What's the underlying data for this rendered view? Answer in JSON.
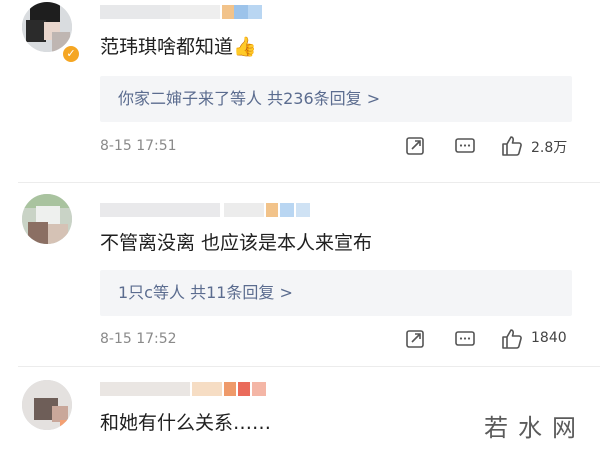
{
  "comments": [
    {
      "text": "范玮琪啥都知道👍",
      "reply_link": "你家二婶子来了等人  共236条回复 >",
      "date": "8-15 17:51",
      "likes": "2.8万",
      "verified": true
    },
    {
      "text": "不管离没离 也应该是本人来宣布",
      "reply_link": "1只c等人  共11条回复 >",
      "date": "8-15 17:52",
      "likes": "1840",
      "verified": false
    },
    {
      "text": "和她有什么关系……",
      "verified": false
    }
  ],
  "watermark": "若水网",
  "icons": [
    "share-icon",
    "comment-icon",
    "like-icon"
  ]
}
